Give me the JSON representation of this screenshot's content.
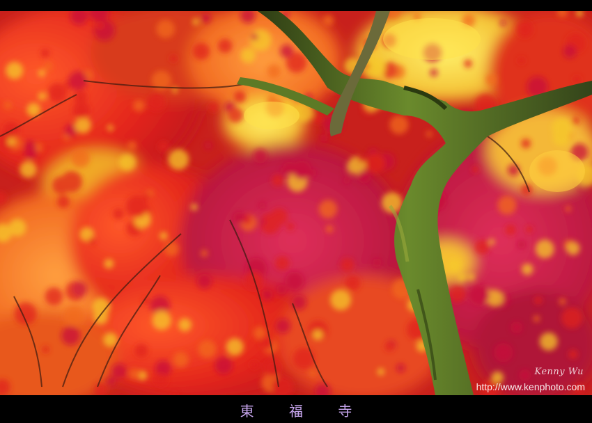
{
  "photo": {
    "subject": "Autumn maple foliage with a moss-covered tree trunk",
    "signature": "Kenny Wu",
    "url": "http://www.kenphoto.com"
  },
  "caption": {
    "title": "東 福 寺"
  },
  "colors": {
    "frame": "#000000",
    "caption_text": "#c9a7f0",
    "leaf_red": "#e0201c",
    "leaf_orange": "#f26a1e",
    "leaf_yellow": "#f6c92a",
    "leaf_crimson": "#c8103a",
    "moss": "#5a7a26",
    "bark": "#3c4a1c"
  }
}
